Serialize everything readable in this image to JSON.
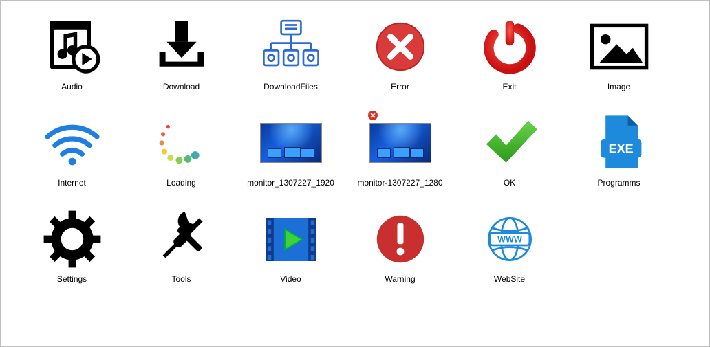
{
  "items": [
    {
      "id": "audio",
      "label": "Audio"
    },
    {
      "id": "download",
      "label": "Download"
    },
    {
      "id": "downloadfiles",
      "label": "DownloadFiles"
    },
    {
      "id": "error",
      "label": "Error"
    },
    {
      "id": "exit",
      "label": "Exit"
    },
    {
      "id": "image",
      "label": "Image"
    },
    {
      "id": "internet",
      "label": "Internet"
    },
    {
      "id": "loading",
      "label": "Loading"
    },
    {
      "id": "monitor1920",
      "label": "monitor_1307227_1920"
    },
    {
      "id": "monitor1280",
      "label": "monitor-1307227_1280"
    },
    {
      "id": "ok",
      "label": "OK"
    },
    {
      "id": "programms",
      "label": "Programms"
    },
    {
      "id": "settings",
      "label": "Settings"
    },
    {
      "id": "tools",
      "label": "Tools"
    },
    {
      "id": "video",
      "label": "Video"
    },
    {
      "id": "warning",
      "label": "Warning"
    },
    {
      "id": "website",
      "label": "WebSite"
    }
  ],
  "exe_text": "EXE",
  "www_text": "WWW"
}
